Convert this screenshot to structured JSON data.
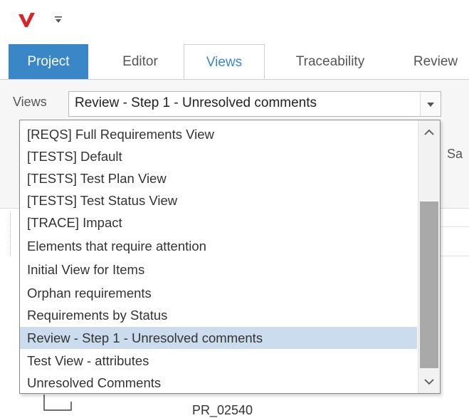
{
  "app": {
    "logo_icon": "vector-logo-icon",
    "logo_color": "#d6262c",
    "qat_icon": "customize-quick-access-icon"
  },
  "tabs": [
    {
      "label": "Project"
    },
    {
      "label": "Editor"
    },
    {
      "label": "Views"
    },
    {
      "label": "Traceability"
    },
    {
      "label": "Review"
    }
  ],
  "views_panel": {
    "label": "Views",
    "selected_value": "Review - Step 1 - Unresolved comments"
  },
  "ribbon": {
    "partial_button_text": "Sa"
  },
  "dropdown": {
    "options": [
      "[REQS] Full Requirements View",
      "[TESTS] Default",
      "[TESTS] Test Plan View",
      "[TESTS] Test Status View",
      "[TRACE] Impact",
      "Elements that require attention",
      "Initial View for Items",
      "Orphan requirements",
      "Requirements by Status",
      "Review - Step 1 - Unresolved comments",
      "Test View - attributes",
      "Unresolved Comments"
    ],
    "highlighted": "Review - Step 1 - Unresolved comments"
  },
  "content": {
    "item_id": "PR_02540"
  },
  "colors": {
    "accent": "#3a87c8",
    "highlight": "#ccdcef"
  }
}
